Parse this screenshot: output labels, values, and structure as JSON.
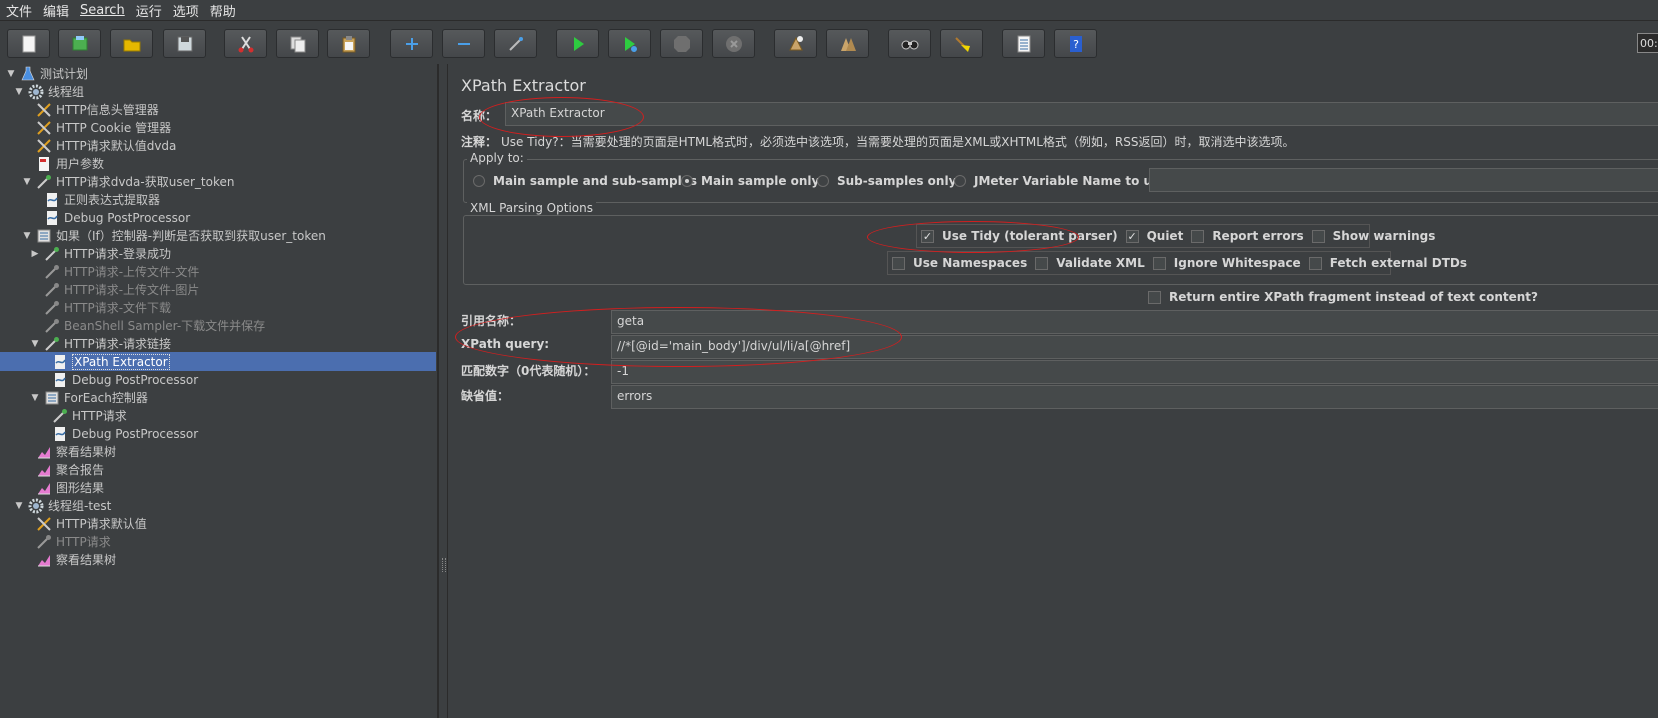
{
  "menu": [
    "文件",
    "编辑",
    "Search",
    "运行",
    "选项",
    "帮助"
  ],
  "toolbar": {
    "buttons": [
      "new-icon",
      "templates-icon",
      "open-icon",
      "save-icon",
      "cut-icon",
      "copy-icon",
      "paste-icon",
      "expand-icon",
      "collapse-icon",
      "toggle-icon",
      "start-icon",
      "start-no-pause-icon",
      "stop-icon",
      "shutdown-icon",
      "clear-icon",
      "clear-all-icon",
      "search-icon",
      "reset-search-icon",
      "function-helper-icon",
      "help-icon"
    ],
    "time": "00:"
  },
  "tree": [
    {
      "label": "测试计划",
      "icon": "flask"
    },
    {
      "label": "线程组",
      "icon": "gear"
    },
    {
      "label": "HTTP信息头管理器",
      "icon": "tools"
    },
    {
      "label": "HTTP Cookie 管理器",
      "icon": "tools"
    },
    {
      "label": "HTTP请求默认值dvda",
      "icon": "tools"
    },
    {
      "label": "用户参数",
      "icon": "doc"
    },
    {
      "label": "HTTP请求dvda-获取user_token",
      "icon": "pipette"
    },
    {
      "label": "正则表达式提取器",
      "icon": "post"
    },
    {
      "label": "Debug PostProcessor",
      "icon": "post"
    },
    {
      "label": "如果（If）控制器-判断是否获取到获取user_token",
      "icon": "controller"
    },
    {
      "label": "HTTP请求-登录成功",
      "icon": "pipette"
    },
    {
      "label": "HTTP请求-上传文件-文件",
      "icon": "pipette-gray"
    },
    {
      "label": "HTTP请求-上传文件-图片",
      "icon": "pipette-gray"
    },
    {
      "label": "HTTP请求-文件下载",
      "icon": "pipette-gray"
    },
    {
      "label": "BeanShell Sampler-下载文件并保存",
      "icon": "pipette-gray"
    },
    {
      "label": "HTTP请求-请求链接",
      "icon": "pipette"
    },
    {
      "label": "XPath Extractor",
      "icon": "post"
    },
    {
      "label": "Debug PostProcessor",
      "icon": "post"
    },
    {
      "label": "ForEach控制器",
      "icon": "controller"
    },
    {
      "label": "HTTP请求",
      "icon": "pipette"
    },
    {
      "label": "Debug PostProcessor",
      "icon": "post"
    },
    {
      "label": "察看结果树",
      "icon": "chart"
    },
    {
      "label": "聚合报告",
      "icon": "chart"
    },
    {
      "label": "图形结果",
      "icon": "chart"
    },
    {
      "label": "线程组-test",
      "icon": "gear"
    },
    {
      "label": "HTTP请求默认值",
      "icon": "tools"
    },
    {
      "label": "HTTP请求",
      "icon": "pipette-gray"
    },
    {
      "label": "察看结果树",
      "icon": "chart"
    }
  ],
  "main": {
    "title": "XPath Extractor",
    "name_label": "名称：",
    "name_value": "XPath Extractor",
    "comment_label": "注释：",
    "comment_text": "Use Tidy?：当需要处理的页面是HTML格式时，必须选中该选项，当需要处理的页面是XML或XHTML格式（例如，RSS返回）时，取消选中该选项。",
    "apply_to": {
      "title": "Apply to:",
      "options": [
        "Main sample and sub-samples",
        "Main sample only",
        "Sub-samples only",
        "JMeter Variable Name to use"
      ],
      "selected": "Main sample only",
      "variable_value": ""
    },
    "xml_parsing": {
      "title": "XML Parsing Options",
      "row1": [
        {
          "label": "Use Tidy (tolerant parser)",
          "checked": true
        },
        {
          "label": "Quiet",
          "checked": true
        },
        {
          "label": "Report errors",
          "checked": false
        },
        {
          "label": "Show warnings",
          "checked": false
        }
      ],
      "row2": [
        {
          "label": "Use Namespaces",
          "checked": false
        },
        {
          "label": "Validate XML",
          "checked": false
        },
        {
          "label": "Ignore Whitespace",
          "checked": false
        },
        {
          "label": "Fetch external DTDs",
          "checked": false
        }
      ]
    },
    "return_fragment": {
      "label": "Return entire XPath fragment instead of text content?",
      "checked": false
    },
    "ref_name_label": "引用名称：",
    "ref_name_value": "geta",
    "xpath_label": "XPath query:",
    "xpath_value": "//*[@id='main_body']/div/ul/li/a[@href]",
    "match_label": "匹配数字（0代表随机）：",
    "match_value": "-1",
    "default_label": "缺省值：",
    "default_value": "errors"
  },
  "colors": {
    "background": "#3c3f41",
    "selection": "#4b6eaf",
    "annotation": "#d21f1f"
  }
}
